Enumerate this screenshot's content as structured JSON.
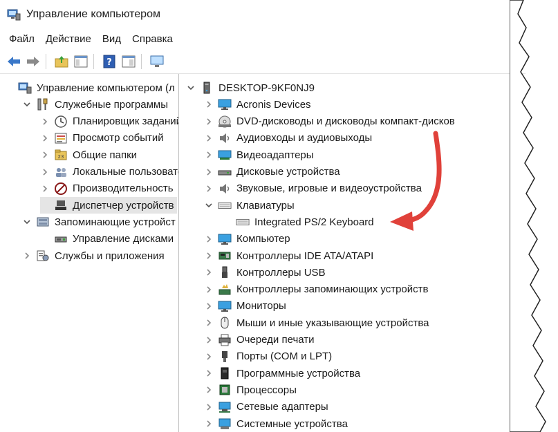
{
  "window": {
    "title": "Управление компьютером"
  },
  "menu": [
    "Файл",
    "Действие",
    "Вид",
    "Справка"
  ],
  "left_tree": [
    {
      "label": "Управление компьютером (л",
      "level": 0,
      "chevron": "",
      "icon": "computer-management-icon"
    },
    {
      "label": "Служебные программы",
      "level": 1,
      "chevron": "down",
      "icon": "tools-icon"
    },
    {
      "label": "Планировщик заданий",
      "level": 2,
      "chevron": "right",
      "icon": "clock-icon"
    },
    {
      "label": "Просмотр событий",
      "level": 2,
      "chevron": "right",
      "icon": "event-viewer-icon"
    },
    {
      "label": "Общие папки",
      "level": 2,
      "chevron": "right",
      "icon": "shared-folder-icon"
    },
    {
      "label": "Локальные пользовате",
      "level": 2,
      "chevron": "right",
      "icon": "users-icon"
    },
    {
      "label": "Производительность",
      "level": 2,
      "chevron": "right",
      "icon": "performance-icon"
    },
    {
      "label": "Диспетчер устройств",
      "level": 2,
      "chevron": "",
      "icon": "device-manager-icon",
      "selected": true
    },
    {
      "label": "Запоминающие устройст",
      "level": 1,
      "chevron": "down",
      "icon": "storage-icon"
    },
    {
      "label": "Управление дисками",
      "level": 2,
      "chevron": "",
      "icon": "disk-management-icon"
    },
    {
      "label": "Службы и приложения",
      "level": 1,
      "chevron": "right",
      "icon": "services-icon"
    }
  ],
  "device_tree": [
    {
      "label": "DESKTOP-9KF0NJ9",
      "level": 0,
      "chevron": "down",
      "icon": "pc-icon"
    },
    {
      "label": "Acronis Devices",
      "level": 1,
      "chevron": "right",
      "icon": "monitor-icon"
    },
    {
      "label": "DVD-дисководы и дисководы компакт-дисков",
      "level": 1,
      "chevron": "right",
      "icon": "dvd-icon"
    },
    {
      "label": "Аудиовходы и аудиовыходы",
      "level": 1,
      "chevron": "right",
      "icon": "speaker-icon"
    },
    {
      "label": "Видеоадаптеры",
      "level": 1,
      "chevron": "right",
      "icon": "video-adapter-icon"
    },
    {
      "label": "Дисковые устройства",
      "level": 1,
      "chevron": "right",
      "icon": "disk-drive-icon"
    },
    {
      "label": "Звуковые, игровые и видеоустройства",
      "level": 1,
      "chevron": "right",
      "icon": "speaker-icon"
    },
    {
      "label": "Клавиатуры",
      "level": 1,
      "chevron": "down",
      "icon": "keyboard-icon"
    },
    {
      "label": "Integrated PS/2 Keyboard",
      "level": 2,
      "chevron": "",
      "icon": "keyboard-icon"
    },
    {
      "label": "Компьютер",
      "level": 1,
      "chevron": "right",
      "icon": "monitor-icon"
    },
    {
      "label": "Контроллеры IDE ATA/ATAPI",
      "level": 1,
      "chevron": "right",
      "icon": "ide-controller-icon"
    },
    {
      "label": "Контроллеры USB",
      "level": 1,
      "chevron": "right",
      "icon": "usb-icon"
    },
    {
      "label": "Контроллеры запоминающих устройств",
      "level": 1,
      "chevron": "right",
      "icon": "storage-controller-icon"
    },
    {
      "label": "Мониторы",
      "level": 1,
      "chevron": "right",
      "icon": "monitor-icon"
    },
    {
      "label": "Мыши и иные указывающие устройства",
      "level": 1,
      "chevron": "right",
      "icon": "mouse-icon"
    },
    {
      "label": "Очереди печати",
      "level": 1,
      "chevron": "right",
      "icon": "printer-icon"
    },
    {
      "label": "Порты (COM и LPT)",
      "level": 1,
      "chevron": "right",
      "icon": "port-icon"
    },
    {
      "label": "Программные устройства",
      "level": 1,
      "chevron": "right",
      "icon": "software-device-icon"
    },
    {
      "label": "Процессоры",
      "level": 1,
      "chevron": "right",
      "icon": "processor-icon"
    },
    {
      "label": "Сетевые адаптеры",
      "level": 1,
      "chevron": "right",
      "icon": "network-adapter-icon"
    },
    {
      "label": "Системные устройства",
      "level": 1,
      "chevron": "right",
      "icon": "system-device-icon"
    }
  ],
  "colors": {
    "annotation_arrow": "#e0413a",
    "selection": "#e5e5e5"
  }
}
